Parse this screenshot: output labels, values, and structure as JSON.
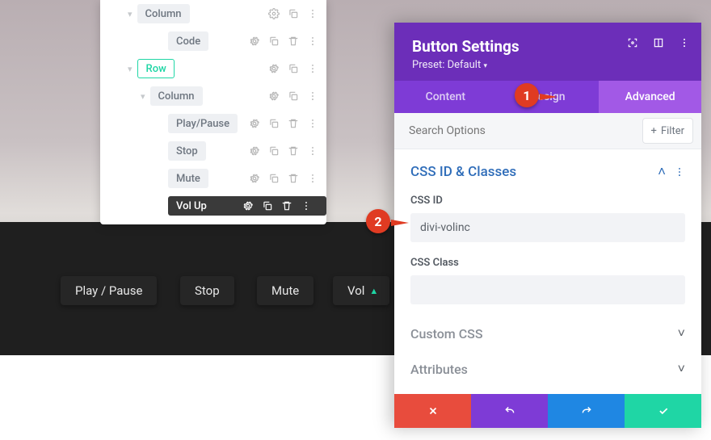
{
  "tree": {
    "rows": [
      {
        "label": "Column",
        "type": "column",
        "indent": 54,
        "actions": "gd-"
      },
      {
        "label": "Code",
        "type": "module",
        "indent": 84,
        "actions": "gdt-"
      },
      {
        "label": "Row",
        "type": "row",
        "indent": 54,
        "actions": "gd-"
      },
      {
        "label": "Column",
        "type": "column",
        "indent": 70,
        "actions": "gd-"
      },
      {
        "label": "Play/Pause",
        "type": "module",
        "indent": 84,
        "actions": "gdt-"
      },
      {
        "label": "Stop",
        "type": "module",
        "indent": 84,
        "actions": "gdt-"
      },
      {
        "label": "Mute",
        "type": "module",
        "indent": 84,
        "actions": "gdt-"
      },
      {
        "label": "Vol Up",
        "type": "module-selected",
        "indent": 84,
        "actions": "gdt-"
      }
    ]
  },
  "buttons": {
    "play": "Play / Pause",
    "stop": "Stop",
    "mute": "Mute",
    "vol": "Vol"
  },
  "panel": {
    "title": "Button Settings",
    "preset": "Preset: Default",
    "tabs": {
      "content": "Content",
      "design": "Design",
      "advanced": "Advanced"
    },
    "search_placeholder": "Search Options",
    "filter_label": "Filter",
    "section1": {
      "title": "CSS ID & Classes",
      "css_id_label": "CSS ID",
      "css_id_value": "divi-volinc",
      "css_class_label": "CSS Class",
      "css_class_value": ""
    },
    "section2": "Custom CSS",
    "section3": "Attributes"
  },
  "callouts": {
    "one": "1",
    "two": "2"
  }
}
